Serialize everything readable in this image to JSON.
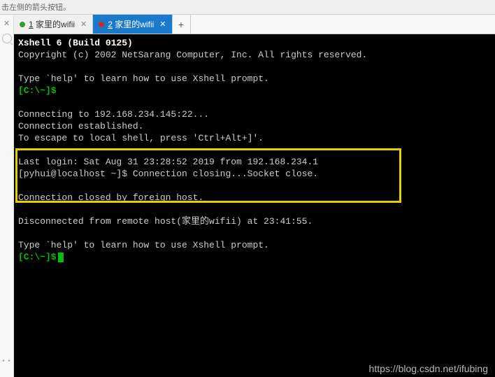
{
  "hint": "击左侧的箭头按钮。",
  "tabs": {
    "inactive": {
      "num": "1",
      "label": "家里的wifii"
    },
    "active": {
      "num": "2",
      "label": "家里的wifii"
    },
    "add": "+"
  },
  "terminal": {
    "title": "Xshell 6 (Build 0125)",
    "copyright": "Copyright (c) 2002 NetSarang Computer, Inc. All rights reserved.",
    "help1": "Type `help' to learn how to use Xshell prompt.",
    "prompt1": "[C:\\~]$",
    "connecting": "Connecting to 192.168.234.145:22...",
    "established": "Connection established.",
    "escape": "To escape to local shell, press 'Ctrl+Alt+]'.",
    "lastlogin": "Last login: Sat Aug 31 23:28:52 2019 from 192.168.234.1",
    "closing": "[pyhui@localhost ~]$ Connection closing...Socket close.",
    "closed": "Connection closed by foreign host.",
    "disconnected": "Disconnected from remote host(家里的wifii) at 23:41:55.",
    "help2": "Type `help' to learn how to use Xshell prompt.",
    "prompt2": "[C:\\~]$"
  },
  "watermark": "https://blog.csdn.net/ifubing"
}
